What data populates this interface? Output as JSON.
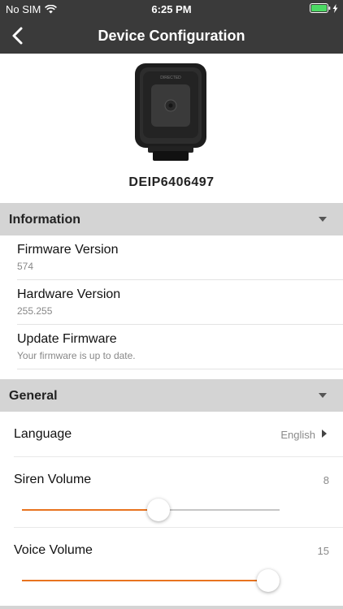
{
  "status_bar": {
    "carrier": "No SIM",
    "time": "6:25 PM"
  },
  "nav": {
    "title": "Device Configuration"
  },
  "device": {
    "id": "DEIP6406497",
    "brand_mark": "DIRECTED"
  },
  "information": {
    "header": "Information",
    "rows": [
      {
        "label": "Firmware Version",
        "value": "574"
      },
      {
        "label": "Hardware Version",
        "value": "255.255"
      },
      {
        "label": "Update Firmware",
        "value": "Your firmware is up to date."
      }
    ]
  },
  "general": {
    "header": "General",
    "language": {
      "label": "Language",
      "value": "English"
    },
    "siren_volume": {
      "label": "Siren Volume",
      "value": "8",
      "level": 0.53
    },
    "voice_volume": {
      "label": "Voice Volume",
      "value": "15",
      "level": 1.0
    }
  },
  "colors": {
    "accent": "#e8731f",
    "bar": "#3a3a3a",
    "section": "#d4d4d4",
    "battery": "#4cd964"
  }
}
